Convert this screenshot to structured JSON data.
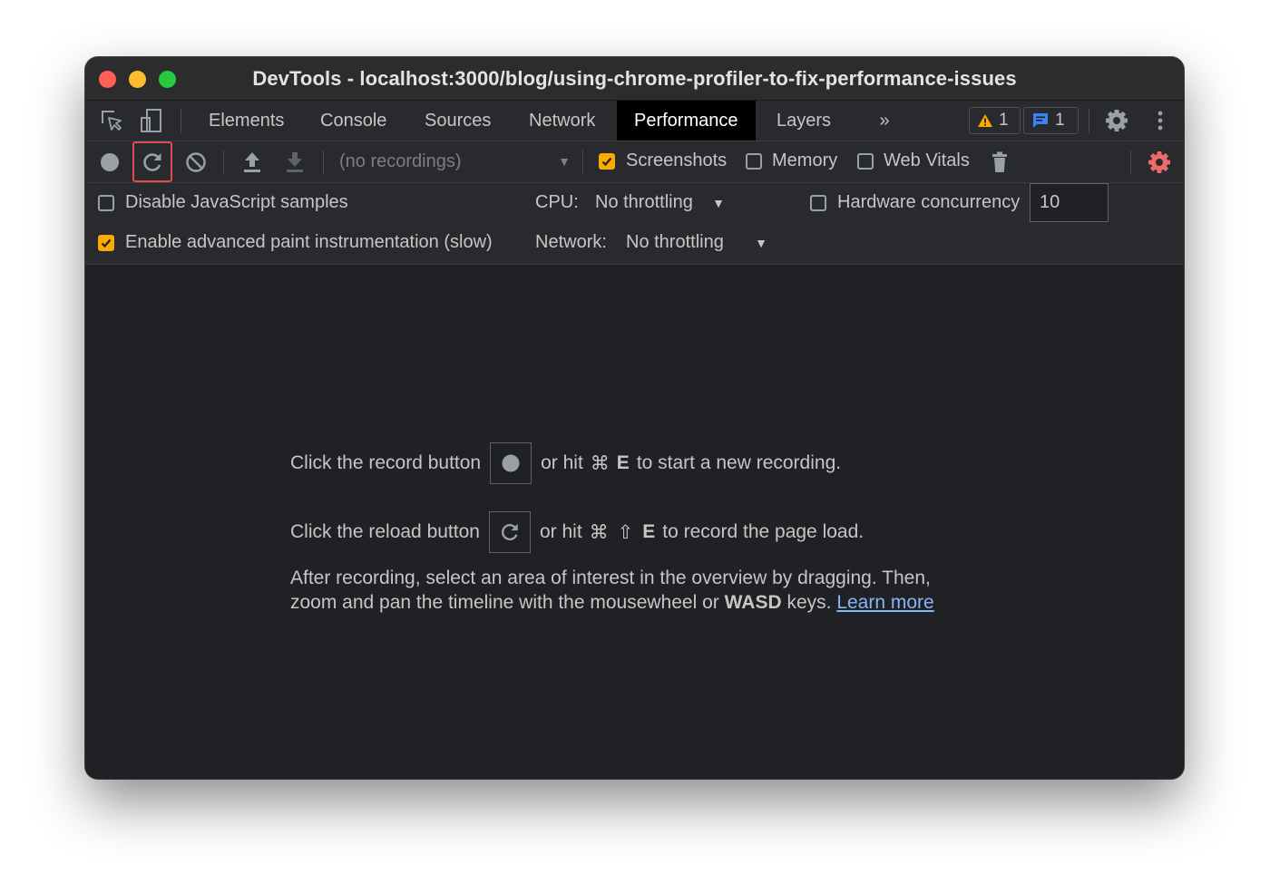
{
  "window": {
    "title": "DevTools - localhost:3000/blog/using-chrome-profiler-to-fix-performance-issues"
  },
  "tabs": [
    {
      "label": "Elements"
    },
    {
      "label": "Console"
    },
    {
      "label": "Sources"
    },
    {
      "label": "Network"
    },
    {
      "label": "Performance",
      "active": true
    },
    {
      "label": "Layers"
    }
  ],
  "badges": {
    "warnings": "1",
    "messages": "1"
  },
  "toolbar": {
    "recordings_select": "(no recordings)",
    "screenshots": {
      "label": "Screenshots",
      "checked": true
    },
    "memory": {
      "label": "Memory",
      "checked": false
    },
    "web_vitals": {
      "label": "Web Vitals",
      "checked": false
    }
  },
  "settings": {
    "disable_js_samples": {
      "label": "Disable JavaScript samples",
      "checked": false
    },
    "advanced_paint": {
      "label": "Enable advanced paint instrumentation (slow)",
      "checked": true
    },
    "cpu": {
      "label": "CPU:",
      "value": "No throttling"
    },
    "network": {
      "label": "Network:",
      "value": "No throttling"
    },
    "hardware_concurrency": {
      "label": "Hardware concurrency",
      "value": "10",
      "checked": false
    }
  },
  "main": {
    "record_line": {
      "before": "Click the record button",
      "middle": "or hit",
      "cmd": "⌘",
      "key": "E",
      "after": "to start a new recording."
    },
    "reload_line": {
      "before": "Click the reload button",
      "middle": "or hit",
      "cmd": "⌘",
      "shift": "⇧",
      "key": "E",
      "after": "to record the page load."
    },
    "help": {
      "line1": "After recording, select an area of interest in the overview by dragging. Then,",
      "line2_before": "zoom and pan the timeline with the mousewheel or",
      "line2_bold": "WASD",
      "line2_after": "keys.",
      "link": "Learn more"
    }
  },
  "colors": {
    "accent_checkbox": "#f9ab00",
    "highlight_box": "#e5484d",
    "warning": "#f9ab00",
    "info": "#3b82f6",
    "capture_settings": "#ee6b6b"
  }
}
